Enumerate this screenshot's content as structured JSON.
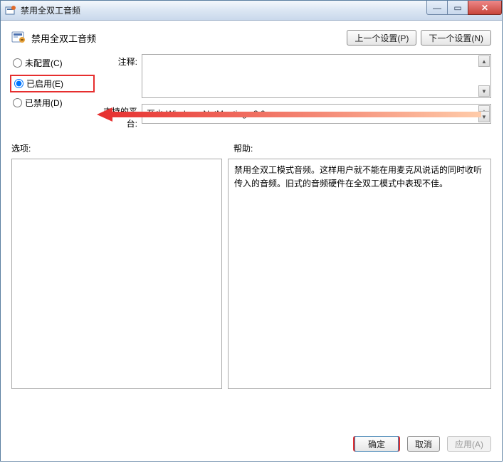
{
  "window": {
    "title": "禁用全双工音频"
  },
  "header": {
    "setting_title": "禁用全双工音频",
    "prev_button": "上一个设置(P)",
    "next_button": "下一个设置(N)"
  },
  "radios": {
    "not_configured": "未配置(C)",
    "enabled": "已启用(E)",
    "disabled": "已禁用(D)"
  },
  "fields": {
    "comment_label": "注释:",
    "platform_label": "支持的平台:",
    "platform_value": "至少 Windows NetMeeting v3.0"
  },
  "sections": {
    "options_label": "选项:",
    "help_label": "帮助:"
  },
  "help_text": "禁用全双工模式音频。这样用户就不能在用麦克风说话的同时收听传入的音频。旧式的音频硬件在全双工模式中表现不佳。",
  "footer": {
    "ok": "确定",
    "cancel": "取消",
    "apply": "应用(A)"
  }
}
